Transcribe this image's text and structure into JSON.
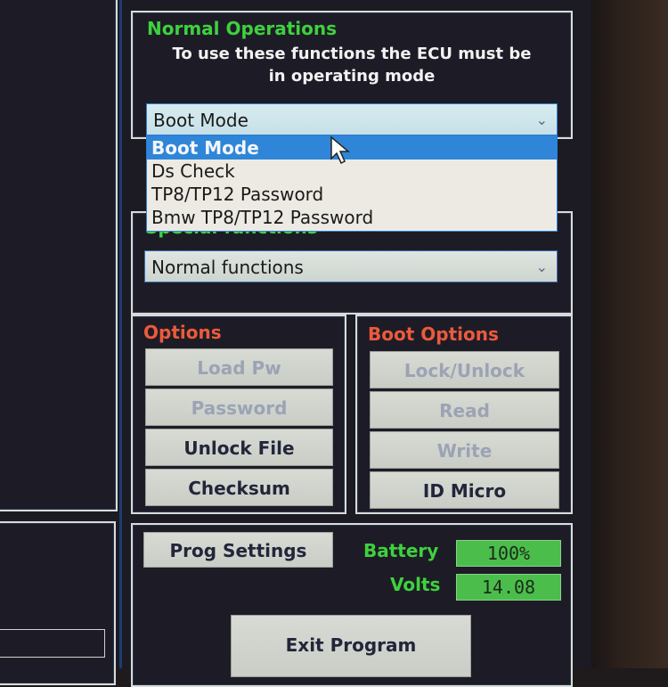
{
  "normal_operations": {
    "title": "Normal Operations",
    "description_line1": "To use these functions the ECU must be",
    "description_line2": "in operating mode",
    "selected": "Boot Mode",
    "options": [
      "Boot Mode",
      "Ds Check",
      "TP8/TP12 Password",
      "Bmw TP8/TP12 Password"
    ],
    "highlighted_option": "Boot Mode"
  },
  "special_functions": {
    "title": "Special functions",
    "selected": "Normal functions"
  },
  "options": {
    "title": "Options",
    "buttons": [
      {
        "label": "Load Pw",
        "enabled": false
      },
      {
        "label": "Password",
        "enabled": false
      },
      {
        "label": "Unlock File",
        "enabled": true
      },
      {
        "label": "Checksum",
        "enabled": true
      }
    ]
  },
  "boot_options": {
    "title": "Boot Options",
    "buttons": [
      {
        "label": "Lock/Unlock",
        "enabled": false
      },
      {
        "label": "Read",
        "enabled": false
      },
      {
        "label": "Write",
        "enabled": false
      },
      {
        "label": "ID Micro",
        "enabled": true
      }
    ]
  },
  "status": {
    "prog_settings_label": "Prog Settings",
    "battery_label": "Battery",
    "battery_value": "100%",
    "volts_label": "Volts",
    "volts_value": "14.08",
    "exit_label": "Exit Program"
  },
  "colors": {
    "group_title_green": "#3ed13e",
    "group_title_red": "#ec5a3c",
    "selection_blue": "#2f86d8",
    "indicator_green": "#4bbd4b"
  }
}
